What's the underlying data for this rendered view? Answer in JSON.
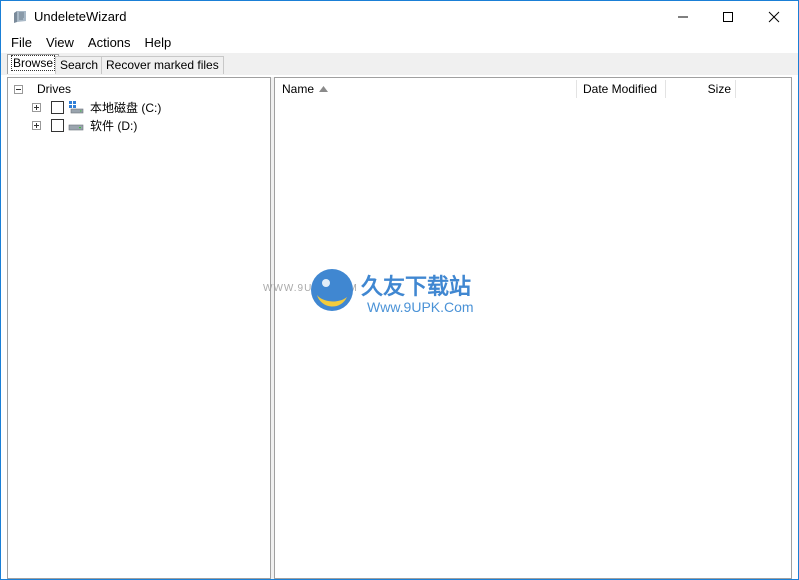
{
  "window": {
    "title": "UndeleteWizard",
    "accent": "#1a7fd6"
  },
  "menu": {
    "items": [
      "File",
      "View",
      "Actions",
      "Help"
    ]
  },
  "tabs": [
    {
      "label": "Browse",
      "active": true
    },
    {
      "label": "Search",
      "active": false
    },
    {
      "label": "Recover marked files",
      "active": false
    }
  ],
  "tree": {
    "root": "Drives",
    "items": [
      {
        "label": "本地磁盘 (C:)",
        "icon": "system-drive-icon"
      },
      {
        "label": "软件 (D:)",
        "icon": "hard-drive-icon"
      }
    ]
  },
  "list": {
    "columns": [
      "Name",
      "Date Modified",
      "Size"
    ]
  },
  "watermark": {
    "small": "WWW.9UPK.COM",
    "brand": "久友下载站",
    "url": "Www.9UPK.Com"
  }
}
